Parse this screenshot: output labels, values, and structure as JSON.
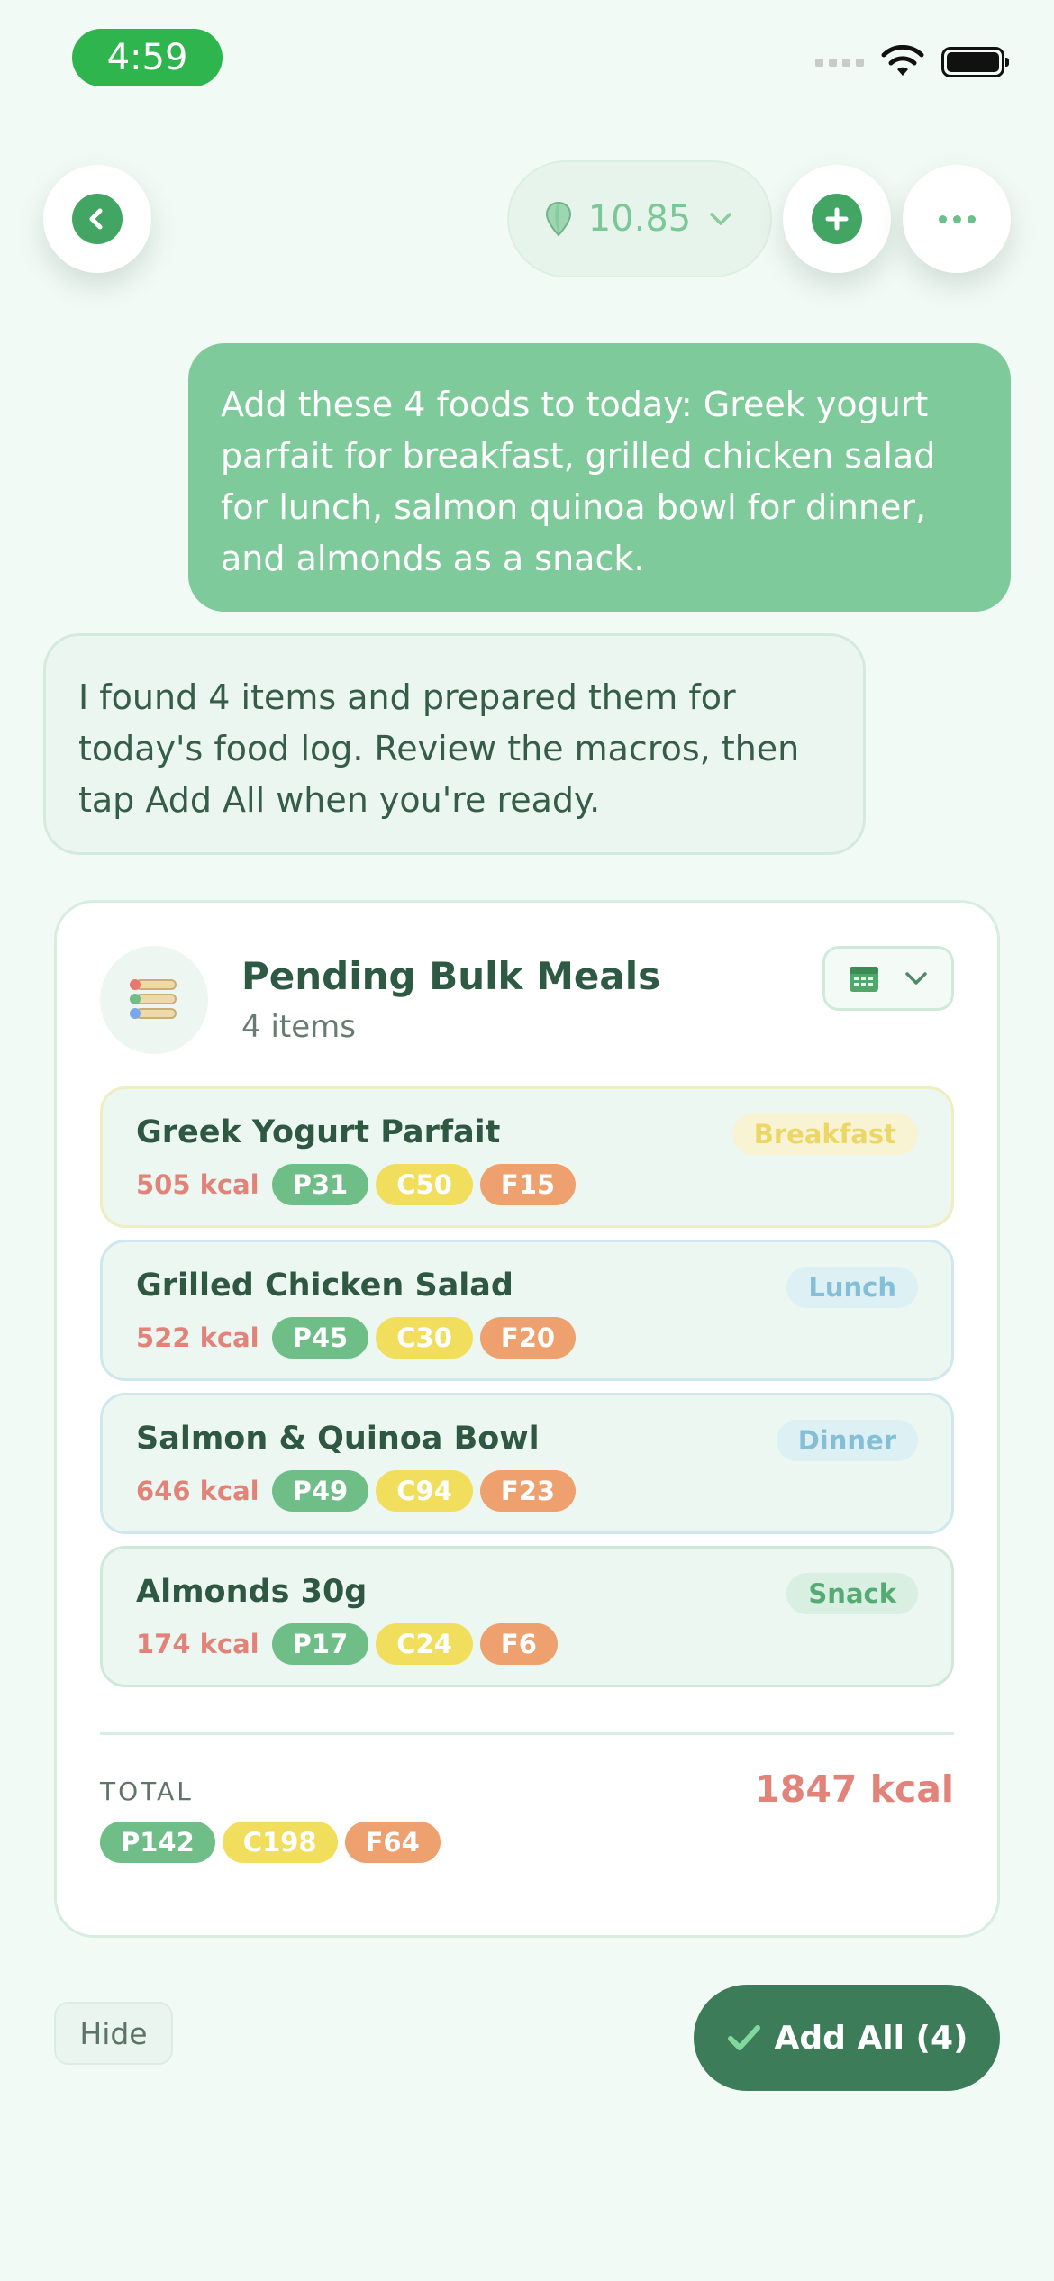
{
  "status_bar": {
    "time": "4:59"
  },
  "header": {
    "balance_value": "10.85",
    "icons": {
      "back": "chevron-left-icon",
      "add": "plus-icon",
      "more": "ellipsis-icon",
      "balance": "map-pin-icon",
      "dropdown": "chevron-down-icon"
    }
  },
  "chat": {
    "user_message": "Add these 4 foods to today: Greek yogurt parfait for breakfast, grilled chicken salad for lunch, salmon quinoa bowl for dinner, and almonds as a snack.",
    "assistant_message": "I found 4 items and prepared them for today's food log. Review the macros, then tap Add All when you're ready."
  },
  "card": {
    "title": "Pending Bulk Meals",
    "subtitle": "4 items",
    "meals": [
      {
        "name": "Greek Yogurt Parfait",
        "kcal": "505 kcal",
        "p": "P31",
        "c": "C50",
        "f": "F15",
        "tag": "Breakfast"
      },
      {
        "name": "Grilled Chicken Salad",
        "kcal": "522 kcal",
        "p": "P45",
        "c": "C30",
        "f": "F20",
        "tag": "Lunch"
      },
      {
        "name": "Salmon & Quinoa Bowl",
        "kcal": "646 kcal",
        "p": "P49",
        "c": "C94",
        "f": "F23",
        "tag": "Dinner"
      },
      {
        "name": "Almonds 30g",
        "kcal": "174 kcal",
        "p": "P17",
        "c": "C24",
        "f": "F6",
        "tag": "Snack"
      }
    ],
    "total": {
      "label": "TOTAL",
      "kcal": "1847 kcal",
      "p": "P142",
      "c": "C198",
      "f": "F64"
    }
  },
  "actions": {
    "hide_label": "Hide",
    "add_all_label": "Add All (4)"
  },
  "colors": {
    "accent": "#3d7c58",
    "user_bubble": "#7fca9b",
    "kcal": "#e2837a",
    "protein": "#6fbd87",
    "carbs": "#f1de5c",
    "fat": "#eea06e"
  }
}
